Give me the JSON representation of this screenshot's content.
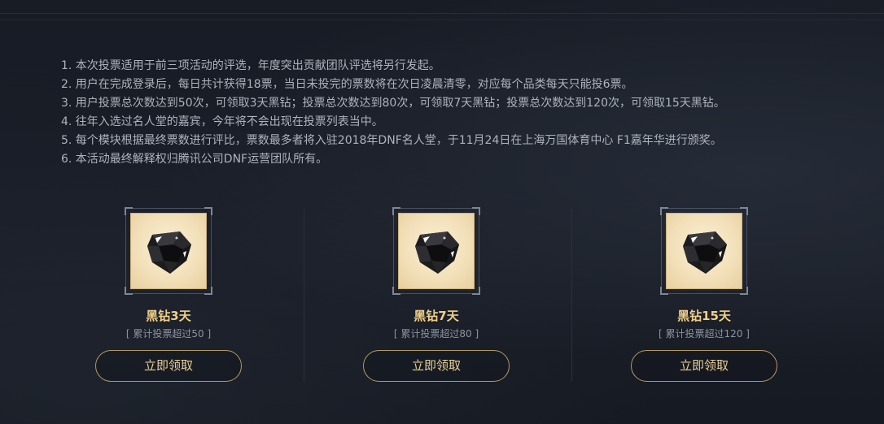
{
  "rules": [
    "1. 本次投票适用于前三项活动的评选，年度突出贡献团队评选将另行发起。",
    "2. 用户在完成登录后，每日共计获得18票，当日未投完的票数将在次日凌晨清零，对应每个品类每天只能投6票。",
    "3. 用户投票总次数达到50次，可领取3天黑钻；投票总次数达到80次，可领取7天黑钻；投票总次数达到120次，可领取15天黑钻。",
    "4. 往年入选过名人堂的嘉宾，今年将不会出现在投票列表当中。",
    "5. 每个模块根据最终票数进行评比，票数最多者将入驻2018年DNF名人堂，于11月24日在上海万国体育中心 F1嘉年华进行颁奖。",
    "6. 本活动最终解释权归腾讯公司DNF运营团队所有。"
  ],
  "rewards": [
    {
      "icon": "black-diamond-icon",
      "name": "黑钻3天",
      "requirement": "[ 累计投票超过50 ]",
      "button_label": "立即领取"
    },
    {
      "icon": "black-diamond-icon",
      "name": "黑钻7天",
      "requirement": "[ 累计投票超过80 ]",
      "button_label": "立即领取"
    },
    {
      "icon": "black-diamond-icon",
      "name": "黑钻15天",
      "requirement": "[ 累计投票超过120 ]",
      "button_label": "立即领取"
    }
  ],
  "colors": {
    "background": "#171b24",
    "rule_text": "#aeb3bd",
    "reward_name": "#f1cf87",
    "button_border": "#b29a63"
  }
}
